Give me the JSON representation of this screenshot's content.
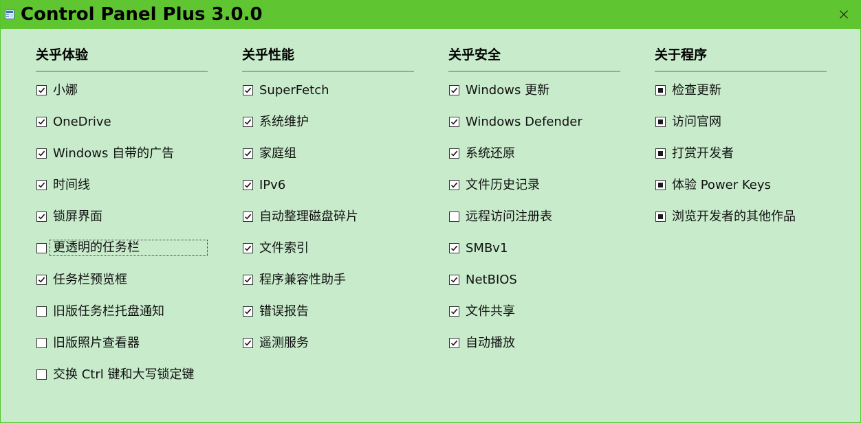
{
  "window": {
    "title": "Control Panel Plus 3.0.0",
    "close_icon": "close-icon"
  },
  "colors": {
    "titlebar": "#5fc631",
    "background": "#c8ebcb",
    "border": "#53c62a"
  },
  "columns": [
    {
      "header": "关乎体验",
      "items": [
        {
          "label": "小娜",
          "checked": true
        },
        {
          "label": "OneDrive",
          "checked": true
        },
        {
          "label": "Windows 自带的广告",
          "checked": true
        },
        {
          "label": "时间线",
          "checked": true
        },
        {
          "label": "锁屏界面",
          "checked": true
        },
        {
          "label": "更透明的任务栏",
          "checked": false,
          "focused": true
        },
        {
          "label": "任务栏预览框",
          "checked": true
        },
        {
          "label": "旧版任务栏托盘通知",
          "checked": false
        },
        {
          "label": "旧版照片查看器",
          "checked": false
        },
        {
          "label": "交换 Ctrl 键和大写锁定键",
          "checked": false
        }
      ]
    },
    {
      "header": "关乎性能",
      "items": [
        {
          "label": "SuperFetch",
          "checked": true
        },
        {
          "label": "系统维护",
          "checked": true
        },
        {
          "label": "家庭组",
          "checked": true
        },
        {
          "label": "IPv6",
          "checked": true
        },
        {
          "label": "自动整理磁盘碎片",
          "checked": true
        },
        {
          "label": "文件索引",
          "checked": true
        },
        {
          "label": "程序兼容性助手",
          "checked": true
        },
        {
          "label": "错误报告",
          "checked": true
        },
        {
          "label": "遥测服务",
          "checked": true
        }
      ]
    },
    {
      "header": "关乎安全",
      "items": [
        {
          "label": "Windows 更新",
          "checked": true
        },
        {
          "label": "Windows Defender",
          "checked": true
        },
        {
          "label": "系统还原",
          "checked": true
        },
        {
          "label": "文件历史记录",
          "checked": true
        },
        {
          "label": "远程访问注册表",
          "checked": false
        },
        {
          "label": "SMBv1",
          "checked": true
        },
        {
          "label": "NetBIOS",
          "checked": true
        },
        {
          "label": "文件共享",
          "checked": true
        },
        {
          "label": "自动播放",
          "checked": true
        }
      ]
    },
    {
      "header": "关于程序",
      "items": [
        {
          "label": "检查更新",
          "indeterminate": true
        },
        {
          "label": "访问官网",
          "indeterminate": true
        },
        {
          "label": "打赏开发者",
          "indeterminate": true
        },
        {
          "label": "体验 Power Keys",
          "indeterminate": true
        },
        {
          "label": "浏览开发者的其他作品",
          "indeterminate": true
        }
      ]
    }
  ]
}
